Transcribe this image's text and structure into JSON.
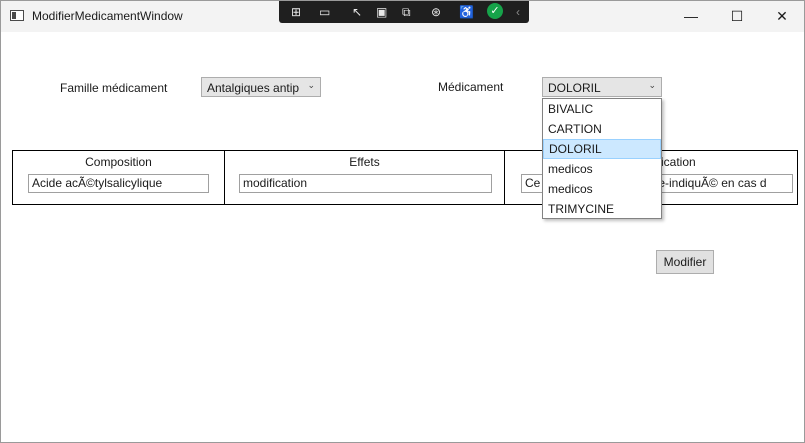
{
  "window": {
    "title": "ModifierMedicamentWindow"
  },
  "titlebar_controls": {
    "minimize": "—",
    "maximize": "☐",
    "close": "✕"
  },
  "debug_toolbar": {
    "icons": [
      "live-visual-tree-icon",
      "record-icon",
      "select-element-icon",
      "display-layout-adorners-icon",
      "track-focus-icon",
      "hot-reload-icon",
      "accessibility-icon",
      "binding-ok-icon",
      "collapse-icon"
    ]
  },
  "form": {
    "famille_label": "Famille médicament",
    "famille_value": "Antalgiques antip",
    "medicament_label": "Médicament",
    "medicament_value": "DOLORIL"
  },
  "dropdown": {
    "options": [
      "BIVALIC",
      "CARTION",
      "DOLORIL",
      "medicos",
      "medicos",
      "TRIMYCINE"
    ],
    "selected": "DOLORIL"
  },
  "grid": {
    "composition_header": "Composition",
    "composition_value": "Acide acÃ©tylsalicylique",
    "effets_header": "Effets",
    "effets_value": "modification",
    "contre_header": "ication",
    "contre_value_left": "Ce",
    "contre_value_right": "tre-indiquÃ© en cas d"
  },
  "actions": {
    "modifier_label": "Modifier"
  },
  "colors": {
    "selected_item_bg": "#cce8ff",
    "selected_item_border": "#99d1ff",
    "binding_ok": "#16a34a"
  }
}
